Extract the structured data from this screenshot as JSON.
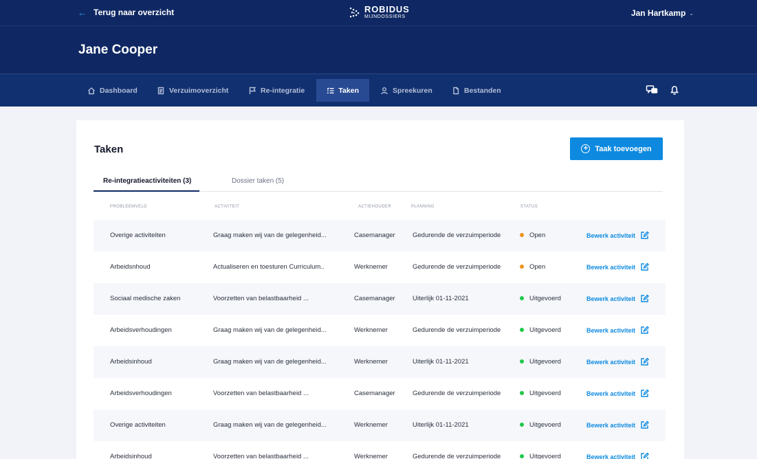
{
  "topbar": {
    "back_label": "Terug naar overzicht",
    "logo_brand": "ROBIDUS",
    "logo_sub": "MIJNDOSSIERS",
    "user_name": "Jan Hartkamp"
  },
  "header": {
    "title": "Jane Cooper"
  },
  "nav": {
    "items": [
      {
        "label": "Dashboard",
        "icon": "home-icon"
      },
      {
        "label": "Verzuimoverzicht",
        "icon": "document-icon"
      },
      {
        "label": "Re-integratie",
        "icon": "flag-icon"
      },
      {
        "label": "Taken",
        "icon": "checklist-icon",
        "active": true
      },
      {
        "label": "Spreekuren",
        "icon": "person-icon"
      },
      {
        "label": "Bestanden",
        "icon": "file-icon"
      }
    ],
    "right_icons": [
      "chat-icon",
      "bell-icon"
    ]
  },
  "card": {
    "title": "Taken",
    "add_button": "Taak toevoegen",
    "tabs": [
      "Re-integratieactiviteiten (3)",
      "Dossier taken (5)"
    ],
    "columns": [
      "Probleemveld",
      "Activiteit",
      "Actiehouder",
      "Planning",
      "Status"
    ],
    "edit_label": "Bewerk activiteit",
    "rows": [
      {
        "probleemveld": "Overige activiteiten",
        "activiteit": "Graag maken wij van de gelegenheid...",
        "actiehouder": "Casemanager",
        "planning": "Gedurende de verzuimperiode",
        "status": "Open"
      },
      {
        "probleemveld": "Arbeidsnhoud",
        "activiteit": "Actualiseren en toesturen Curriculum..",
        "actiehouder": "Werknemer",
        "planning": "Gedurende de verzuimperiode",
        "status": "Open"
      },
      {
        "probleemveld": "Sociaal medische zaken",
        "activiteit": "Voorzetten van belastbaarheid ...",
        "actiehouder": "Casemanager",
        "planning": "Uiterlijk 01-11-2021",
        "status": "Uitgevoerd"
      },
      {
        "probleemveld": "Arbeidsverhoudingen",
        "activiteit": "Graag maken wij van de gelegenheid...",
        "actiehouder": "Werknemer",
        "planning": "Gedurende de verzuimperiode",
        "status": "Uitgevoerd"
      },
      {
        "probleemveld": "Arbeidsinhoud",
        "activiteit": "Graag maken wij van de gelegenheid...",
        "actiehouder": "Werknemer",
        "planning": "Uiterlijk 01-11-2021",
        "status": "Uitgevoerd"
      },
      {
        "probleemveld": "Arbeidsverhoudingen",
        "activiteit": "Voorzetten van belastbaarheid ...",
        "actiehouder": "Casemanager",
        "planning": "Gedurende de verzuimperiode",
        "status": "Uitgevoerd"
      },
      {
        "probleemveld": "Overige activiteiten",
        "activiteit": "Graag maken wij van de gelegenheid...",
        "actiehouder": "Werknemer",
        "planning": "Uiterlijk 01-11-2021",
        "status": "Uitgevoerd"
      },
      {
        "probleemveld": "Arbeidsinhoud",
        "activiteit": "Voorzetten van belastbaarheid ...",
        "actiehouder": "Werknemer",
        "planning": "Gedurende de verzuimperiode",
        "status": "Uitgevoerd"
      }
    ]
  },
  "colors": {
    "navy": "#0f2863",
    "accent": "#0d8ae0",
    "status_open": "#f0921f",
    "status_done": "#1ec84a"
  }
}
